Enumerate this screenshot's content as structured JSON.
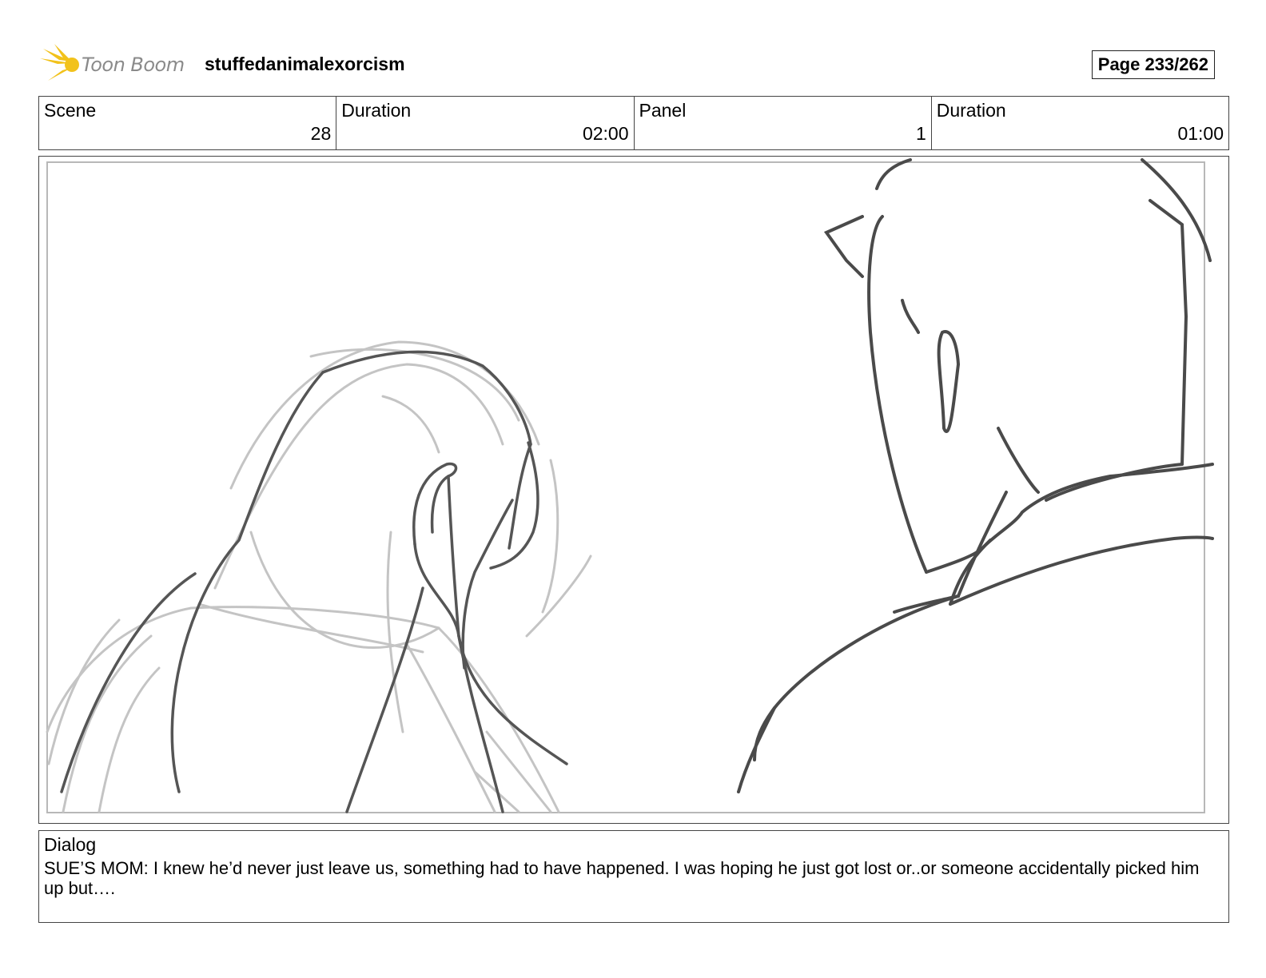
{
  "header": {
    "logo_text": "Toon Boom",
    "project_title": "stuffedanimalexorcism",
    "page": "Page 233/262"
  },
  "info": [
    {
      "label": "Scene",
      "value": "28"
    },
    {
      "label": "Duration",
      "value": "02:00"
    },
    {
      "label": "Panel",
      "value": "1"
    },
    {
      "label": "Duration",
      "value": "01:00"
    }
  ],
  "dialog": {
    "label": "Dialog",
    "text": "SUE’S MOM: I knew he’d never just leave us, something had to have happened. I was hoping he just got lost or..or someone accidentally picked him up but…."
  }
}
